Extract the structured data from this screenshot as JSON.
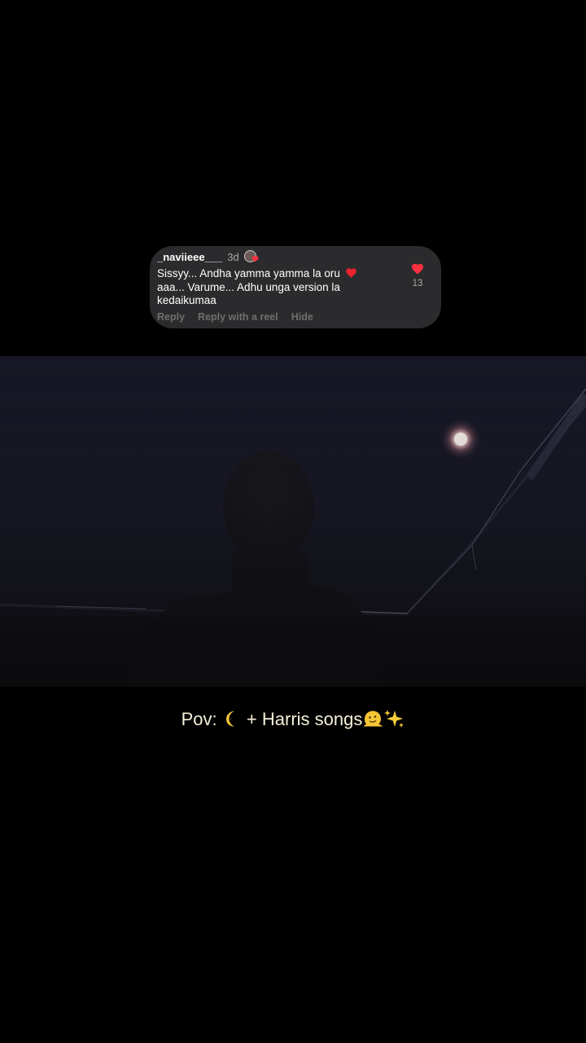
{
  "comment": {
    "username": "_naviieee___",
    "time": "3d",
    "text_before_heart": "Sissyy... Andha yamma yamma la oru",
    "text_after_heart": "aaa... Varume... Adhu unga version la kedaikumaa",
    "like_count": "13",
    "actions": {
      "reply": "Reply",
      "reply_with_reel": "Reply with a reel",
      "hide": "Hide"
    }
  },
  "video": {
    "scene": "night sky with moon and silhouette"
  },
  "caption": {
    "prefix": "Pov:",
    "middle": "+ Harris songs",
    "icons": [
      "crescent-moon-icon",
      "melting-face-icon",
      "sparkles-icon"
    ]
  },
  "colors": {
    "heart": "#ff3040",
    "card_bg": "#2b2b2d",
    "caption_text": "#f5f0d8"
  }
}
